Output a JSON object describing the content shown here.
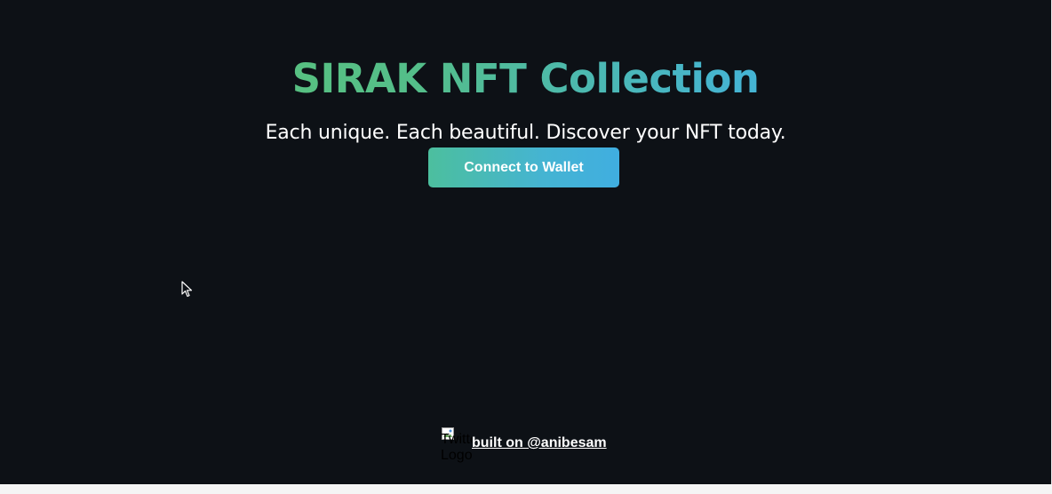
{
  "header": {
    "title": "SIRAK NFT Collection",
    "subtitle": "Each unique. Each beautiful. Discover your NFT today."
  },
  "actions": {
    "connect_wallet_label": "Connect to Wallet"
  },
  "footer": {
    "twitter_logo_alt": "Twitter Logo",
    "built_on_link_text": "built on @anibesam"
  },
  "theme": {
    "background": "#0d1116",
    "title_gradient_start": "#5ec46d",
    "title_gradient_end": "#3faee5",
    "button_gradient_start": "#4cbf9e",
    "button_gradient_end": "#40aee0",
    "text_color": "#ffffff"
  },
  "icons": {
    "cursor": "mouse-pointer-icon",
    "broken_image": "broken-image-icon"
  }
}
